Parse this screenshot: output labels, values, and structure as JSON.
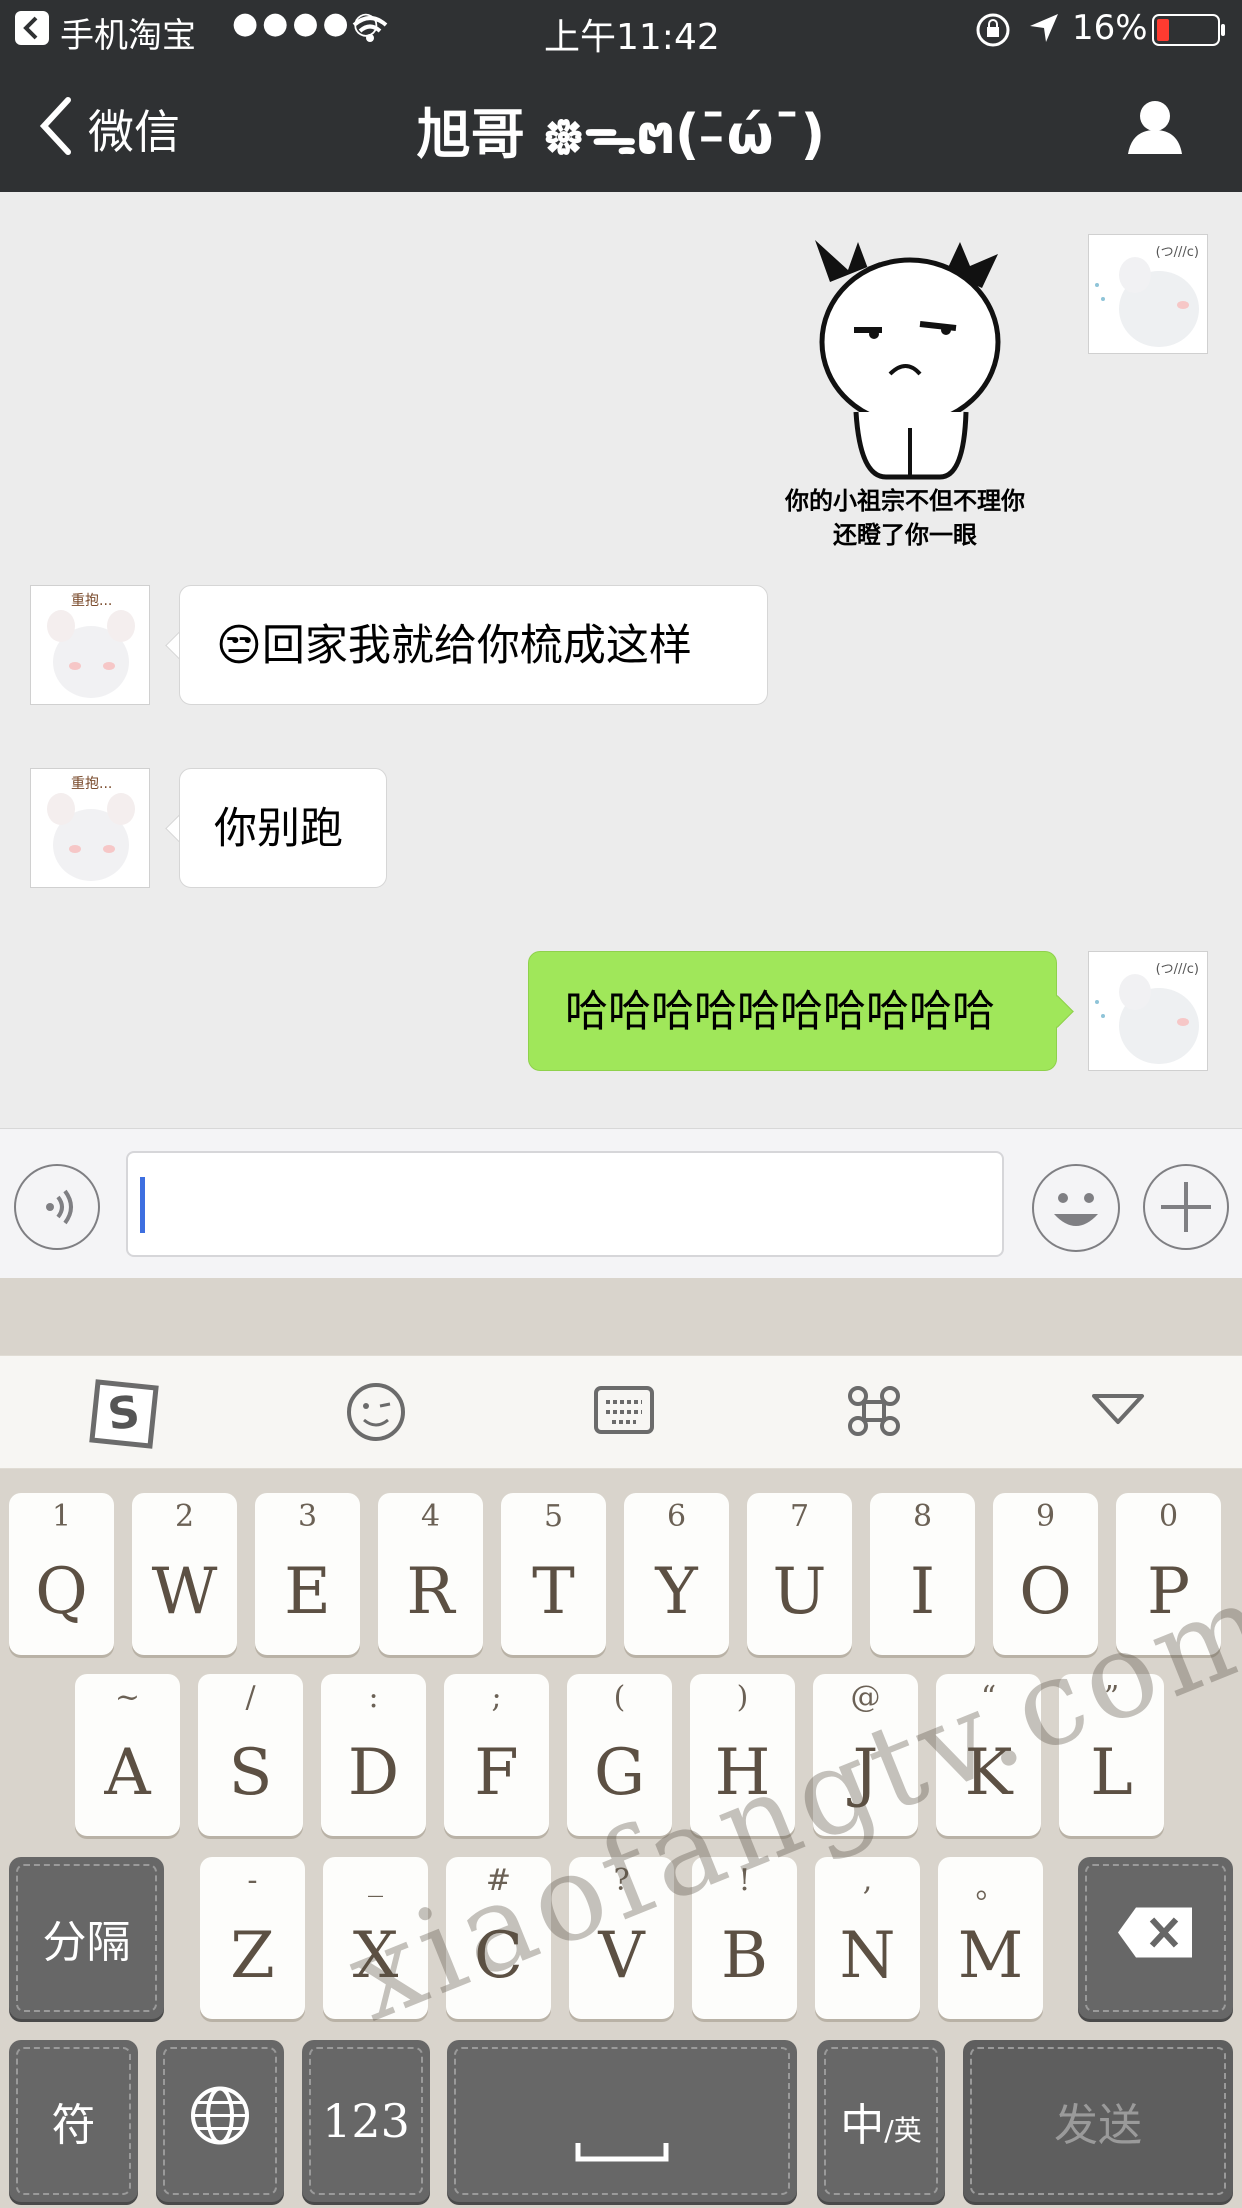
{
  "status_bar": {
    "back_app": "手机淘宝",
    "signal": "●●●●○",
    "time": "上午11:42",
    "battery_percent": "16%"
  },
  "nav": {
    "back_label": "微信",
    "title": "旭哥 ᪥ᯓຕ(ˉ̵ώˉ)"
  },
  "chat": {
    "sticker_caption_line1": "你的小祖宗不但不理你",
    "sticker_caption_line2": "还瞪了你一眼",
    "avatar_text_left": "重抱...",
    "avatar_text_right": "(つ///c)",
    "messages": [
      {
        "side": "in",
        "emoji": "😒",
        "text": "回家我就给你梳成这样"
      },
      {
        "side": "in",
        "text": "你别跑"
      },
      {
        "side": "out",
        "text": "哈哈哈哈哈哈哈哈哈哈"
      }
    ]
  },
  "input": {
    "placeholder": ""
  },
  "keyboard": {
    "row1": [
      {
        "k": "Q",
        "s": "1"
      },
      {
        "k": "W",
        "s": "2"
      },
      {
        "k": "E",
        "s": "3"
      },
      {
        "k": "R",
        "s": "4"
      },
      {
        "k": "T",
        "s": "5"
      },
      {
        "k": "Y",
        "s": "6"
      },
      {
        "k": "U",
        "s": "7"
      },
      {
        "k": "I",
        "s": "8"
      },
      {
        "k": "O",
        "s": "9"
      },
      {
        "k": "P",
        "s": "0"
      }
    ],
    "row2": [
      {
        "k": "A",
        "s": "~"
      },
      {
        "k": "S",
        "s": "/"
      },
      {
        "k": "D",
        "s": ":"
      },
      {
        "k": "F",
        "s": ";"
      },
      {
        "k": "G",
        "s": "("
      },
      {
        "k": "H",
        "s": ")"
      },
      {
        "k": "J",
        "s": "@"
      },
      {
        "k": "K",
        "s": "“"
      },
      {
        "k": "L",
        "s": "”"
      }
    ],
    "row3": [
      {
        "k": "Z",
        "s": "-"
      },
      {
        "k": "X",
        "s": "_"
      },
      {
        "k": "C",
        "s": "#"
      },
      {
        "k": "V",
        "s": "?"
      },
      {
        "k": "B",
        "s": "!"
      },
      {
        "k": "N",
        "s": ","
      },
      {
        "k": "M",
        "s": "。"
      }
    ],
    "separator_label": "分隔",
    "symbol_label": "符",
    "numbers_label": "123",
    "lang_label_main": "中",
    "lang_label_sub": "/英",
    "send_label": "发送"
  },
  "watermark": "xiaofangtv.com"
}
